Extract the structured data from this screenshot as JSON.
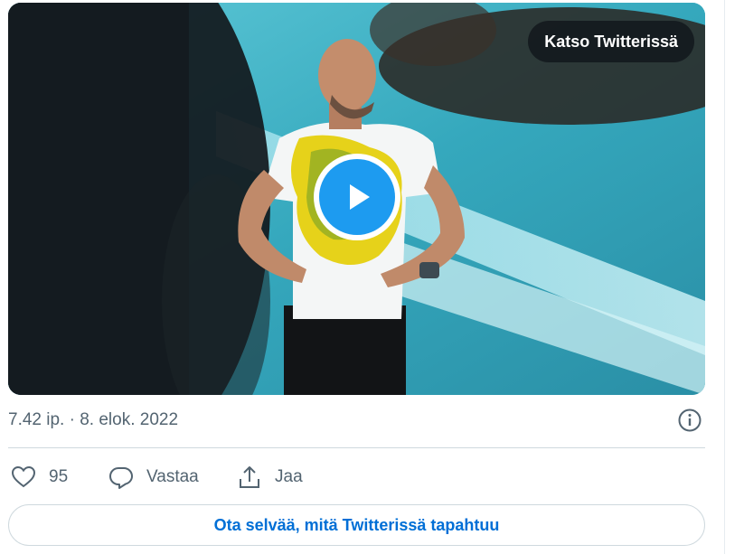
{
  "media": {
    "watch_label": "Katso Twitterissä"
  },
  "tweet": {
    "timestamp": "7.42 ip. · 8. elok. 2022"
  },
  "actions": {
    "like_count": "95",
    "reply_label": "Vastaa",
    "share_label": "Jaa"
  },
  "cta": {
    "label": "Ota selvää, mitä Twitterissä tapahtuu"
  },
  "colors": {
    "accent": "#1d9bf0",
    "link": "#006fd6",
    "muted": "#536471",
    "border": "#cfd9de"
  }
}
